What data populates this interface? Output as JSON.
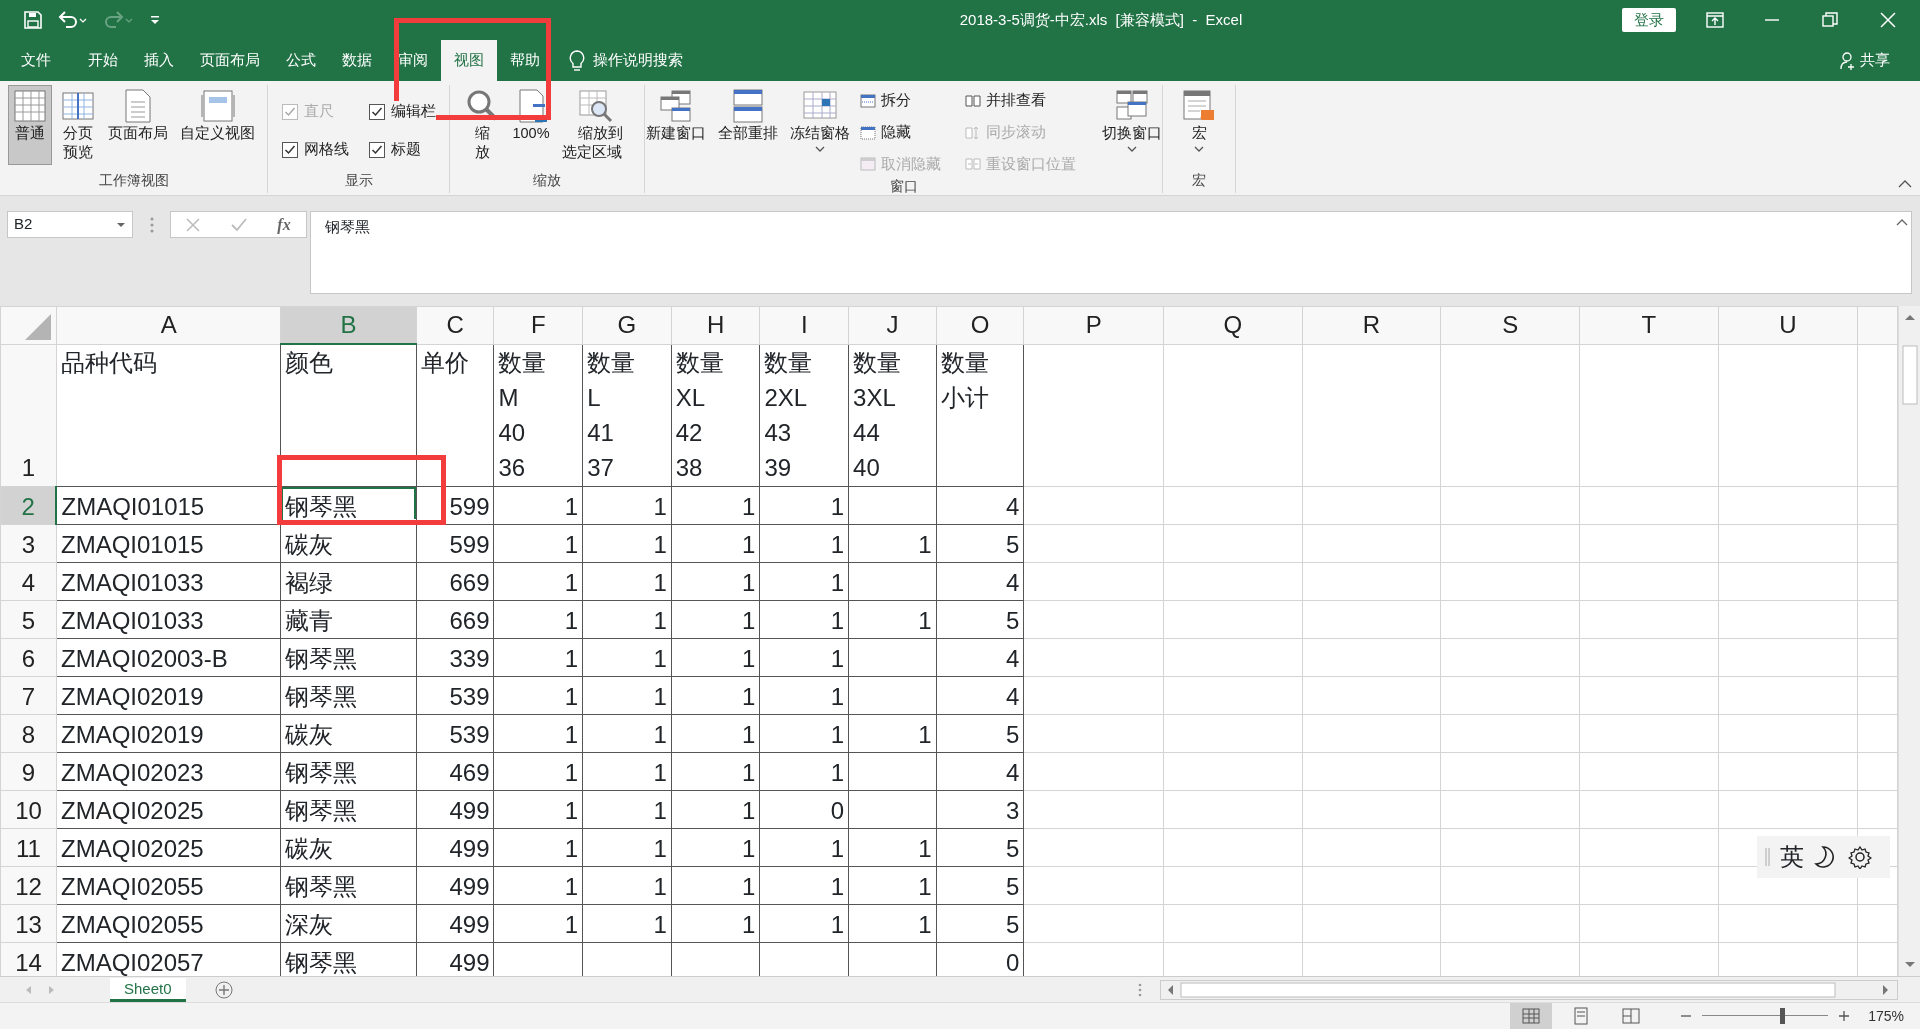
{
  "window": {
    "title": "2018-3-5调货-中宏.xls  [兼容模式]  -  Excel",
    "sign_in": "登录"
  },
  "tabs": [
    {
      "label": "文件",
      "selected": false
    },
    {
      "label": "开始",
      "selected": false
    },
    {
      "label": "插入",
      "selected": false
    },
    {
      "label": "页面布局",
      "selected": false
    },
    {
      "label": "公式",
      "selected": false
    },
    {
      "label": "数据",
      "selected": false
    },
    {
      "label": "审阅",
      "selected": false
    },
    {
      "label": "视图",
      "selected": true
    },
    {
      "label": "帮助",
      "selected": false
    }
  ],
  "tell_me": "操作说明搜索",
  "share": "共享",
  "ribbon_groups": [
    {
      "label": "工作簿视图",
      "items": [
        {
          "kind": "large",
          "label": "普通",
          "selected": true
        },
        {
          "kind": "large",
          "label": "分页预览",
          "selected": false
        },
        {
          "kind": "large",
          "label": "页面布局",
          "selected": false
        },
        {
          "kind": "large",
          "label": "自定义视图",
          "selected": false
        }
      ]
    },
    {
      "label": "显示",
      "items": [
        {
          "kind": "check",
          "label": "直尺",
          "checked": true,
          "disabled": true
        },
        {
          "kind": "check",
          "label": "编辑栏",
          "checked": true,
          "disabled": false
        },
        {
          "kind": "check",
          "label": "网格线",
          "checked": true,
          "disabled": false
        },
        {
          "kind": "check",
          "label": "标题",
          "checked": true,
          "disabled": false
        }
      ]
    },
    {
      "label": "缩放",
      "items": [
        {
          "kind": "large",
          "label": "缩放",
          "selected": false
        },
        {
          "kind": "large",
          "label": "100%",
          "selected": false
        },
        {
          "kind": "large",
          "label": "缩放到选定区域",
          "selected": false
        }
      ]
    },
    {
      "label": "窗口",
      "items": [
        {
          "kind": "large",
          "label": "新建窗口",
          "selected": false
        },
        {
          "kind": "large",
          "label": "全部重排",
          "selected": false
        },
        {
          "kind": "large",
          "label": "冻结窗格",
          "selected": false,
          "dropdown": true
        },
        {
          "kind": "stack",
          "items": [
            {
              "label": "拆分",
              "disabled": false
            },
            {
              "label": "隐藏",
              "disabled": false
            },
            {
              "label": "取消隐藏",
              "disabled": true
            }
          ]
        },
        {
          "kind": "stack",
          "items": [
            {
              "label": "并排查看",
              "disabled": false
            },
            {
              "label": "同步滚动",
              "disabled": true
            },
            {
              "label": "重设窗口位置",
              "disabled": true
            }
          ]
        },
        {
          "kind": "large",
          "label": "切换窗口",
          "selected": false,
          "dropdown": true
        }
      ]
    },
    {
      "label": "宏",
      "items": [
        {
          "kind": "large",
          "label": "宏",
          "selected": false,
          "dropdown": true
        }
      ]
    }
  ],
  "formula_bar": {
    "name_box": "B2",
    "function_label": "fx",
    "value": "钢琴黑"
  },
  "columns": [
    {
      "label": "A",
      "selected": false
    },
    {
      "label": "B",
      "selected": true
    },
    {
      "label": "C",
      "selected": false
    },
    {
      "label": "F",
      "selected": false
    },
    {
      "label": "G",
      "selected": false
    },
    {
      "label": "H",
      "selected": false
    },
    {
      "label": "I",
      "selected": false
    },
    {
      "label": "J",
      "selected": false
    },
    {
      "label": "O",
      "selected": false
    },
    {
      "label": "P",
      "selected": false
    },
    {
      "label": "Q",
      "selected": false
    },
    {
      "label": "R",
      "selected": false
    },
    {
      "label": "S",
      "selected": false
    },
    {
      "label": "T",
      "selected": false
    },
    {
      "label": "U",
      "selected": false
    }
  ],
  "rows": [
    {
      "number": "1",
      "selected": false,
      "kind": "header",
      "cells": [
        "品种代码",
        "颜色",
        "单价",
        "数量\nM\n40\n36",
        "数量\nL\n41\n37",
        "数量\nXL\n42\n38",
        "数量\n2XL\n43\n39",
        "数量\n3XL\n44\n40",
        "数量小计"
      ]
    },
    {
      "number": "2",
      "selected": true,
      "kind": "data",
      "cells": [
        "ZMAQI01015",
        "钢琴黑",
        "599",
        "1",
        "1",
        "1",
        "1",
        null,
        "4"
      ]
    },
    {
      "number": "3",
      "selected": false,
      "kind": "data",
      "cells": [
        "ZMAQI01015",
        "碳灰",
        "599",
        "1",
        "1",
        "1",
        "1",
        "1",
        "5"
      ]
    },
    {
      "number": "4",
      "selected": false,
      "kind": "data",
      "cells": [
        "ZMAQI01033",
        "褐绿",
        "669",
        "1",
        "1",
        "1",
        "1",
        null,
        "4"
      ]
    },
    {
      "number": "5",
      "selected": false,
      "kind": "data",
      "cells": [
        "ZMAQI01033",
        "藏青",
        "669",
        "1",
        "1",
        "1",
        "1",
        "1",
        "5"
      ]
    },
    {
      "number": "6",
      "selected": false,
      "kind": "data",
      "cells": [
        "ZMAQI02003-B",
        "钢琴黑",
        "339",
        "1",
        "1",
        "1",
        "1",
        null,
        "4"
      ]
    },
    {
      "number": "7",
      "selected": false,
      "kind": "data",
      "cells": [
        "ZMAQI02019",
        "钢琴黑",
        "539",
        "1",
        "1",
        "1",
        "1",
        null,
        "4"
      ]
    },
    {
      "number": "8",
      "selected": false,
      "kind": "data",
      "cells": [
        "ZMAQI02019",
        "碳灰",
        "539",
        "1",
        "1",
        "1",
        "1",
        "1",
        "5"
      ]
    },
    {
      "number": "9",
      "selected": false,
      "kind": "data",
      "cells": [
        "ZMAQI02023",
        "钢琴黑",
        "469",
        "1",
        "1",
        "1",
        "1",
        null,
        "4"
      ]
    },
    {
      "number": "10",
      "selected": false,
      "kind": "data",
      "cells": [
        "ZMAQI02025",
        "钢琴黑",
        "499",
        "1",
        "1",
        "1",
        "0",
        null,
        "3"
      ]
    },
    {
      "number": "11",
      "selected": false,
      "kind": "data",
      "cells": [
        "ZMAQI02025",
        "碳灰",
        "499",
        "1",
        "1",
        "1",
        "1",
        "1",
        "5"
      ]
    },
    {
      "number": "12",
      "selected": false,
      "kind": "data",
      "cells": [
        "ZMAQI02055",
        "钢琴黑",
        "499",
        "1",
        "1",
        "1",
        "1",
        "1",
        "5"
      ]
    },
    {
      "number": "13",
      "selected": false,
      "kind": "data",
      "cells": [
        "ZMAQI02055",
        "深灰",
        "499",
        "1",
        "1",
        "1",
        "1",
        "1",
        "5"
      ]
    },
    {
      "number": "14",
      "selected": false,
      "kind": "data",
      "cells": [
        "ZMAQI02057",
        "钢琴黑",
        "499",
        null,
        null,
        null,
        null,
        null,
        "0"
      ]
    }
  ],
  "sheets": [
    {
      "label": "Sheet0",
      "selected": true
    }
  ],
  "status_bar": {
    "zoom": "175%",
    "zoom_slider": {
      "level": 0.63
    },
    "views": [
      {
        "selected": true
      },
      {
        "selected": false
      },
      {
        "selected": false
      }
    ]
  },
  "ime_bar": {
    "language": "英"
  },
  "highlight_frames": {
    "view_tab": true,
    "active_cell": true
  }
}
